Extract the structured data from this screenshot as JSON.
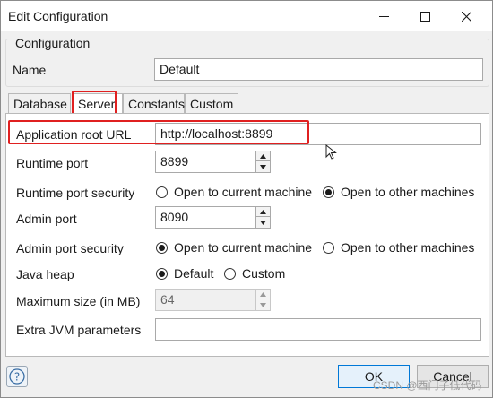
{
  "window": {
    "title": "Edit Configuration",
    "minimize_icon": "minimize-icon",
    "maximize_icon": "maximize-icon",
    "close_icon": "close-icon"
  },
  "configuration": {
    "legend": "Configuration",
    "name_label": "Name",
    "name_value": "Default"
  },
  "tabs": [
    {
      "label": "Database",
      "active": false
    },
    {
      "label": "Server",
      "active": true
    },
    {
      "label": "Constants",
      "active": false
    },
    {
      "label": "Custom",
      "active": false
    }
  ],
  "server": {
    "app_root_url": {
      "label": "Application root URL",
      "value": "http://localhost:8899"
    },
    "runtime_port": {
      "label": "Runtime port",
      "value": "8899"
    },
    "runtime_port_security": {
      "label": "Runtime port security",
      "options": [
        "Open to current machine",
        "Open to other machines"
      ],
      "selected": "Open to other machines"
    },
    "admin_port": {
      "label": "Admin port",
      "value": "8090"
    },
    "admin_port_security": {
      "label": "Admin port security",
      "options": [
        "Open to current machine",
        "Open to other machines"
      ],
      "selected": "Open to current machine"
    },
    "java_heap": {
      "label": "Java heap",
      "options": [
        "Default",
        "Custom"
      ],
      "selected": "Default"
    },
    "max_size": {
      "label": "Maximum size (in MB)",
      "value": "64"
    },
    "extra_jvm": {
      "label": "Extra JVM parameters",
      "value": ""
    }
  },
  "footer": {
    "help_icon": "help-icon",
    "ok_label": "OK",
    "cancel_label": "Cancel"
  },
  "highlight_color": "#e02020",
  "watermark": "CSDN @西门子低代码"
}
